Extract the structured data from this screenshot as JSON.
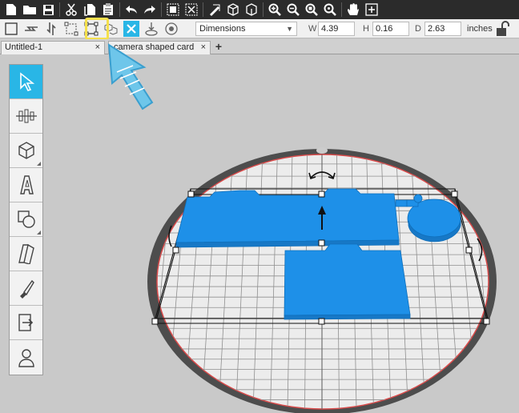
{
  "toolbar": {
    "dimensions_select": "Dimensions",
    "w_label": "W",
    "w_value": "4.39",
    "h_label": "H",
    "h_value": "0.16",
    "d_label": "D",
    "d_value": "2.63",
    "units": "inches"
  },
  "tabs": [
    {
      "label": "Untitled-1",
      "close": "×"
    },
    {
      "label": "camera shaped card",
      "close": "×"
    }
  ],
  "tab_add": "+",
  "colors": {
    "accent": "#29b6e6",
    "highlight": "#f4e04d",
    "model": "#1e90e8",
    "mat_ring": "#4d4d4d",
    "mat_border": "#d94a4a"
  }
}
